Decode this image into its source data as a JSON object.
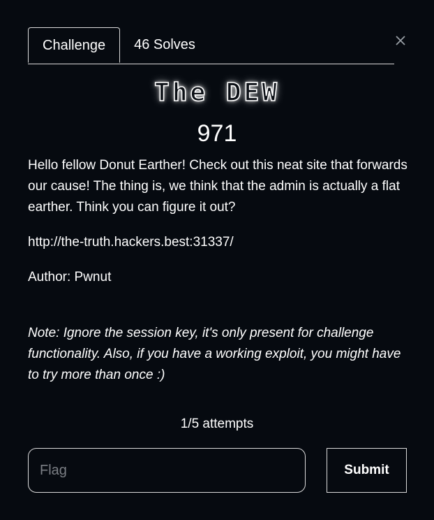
{
  "tabs": [
    {
      "label": "Challenge",
      "active": true
    },
    {
      "label": "46 Solves",
      "active": false
    }
  ],
  "challenge": {
    "title": "The DEW",
    "points": "971",
    "description": "Hello fellow Donut Earther! Check out this neat site that forwards our cause! The thing is, we think that the admin is actually a flat earther. Think you can figure it out?",
    "url": "http://the-truth.hackers.best:31337/",
    "author": "Author: Pwnut",
    "note": "Note: Ignore the session key, it's only present for challenge functionality. Also, if you have a working exploit, you might have to try more than once :)"
  },
  "attempts": "1/5 attempts",
  "flag_input": {
    "placeholder": "Flag",
    "value": ""
  },
  "submit_label": "Submit",
  "icons": {
    "close": "close-icon"
  },
  "colors": {
    "background": "#060a10",
    "text": "#ffffff",
    "border": "#dcdcdc",
    "placeholder": "#7b7f85"
  }
}
